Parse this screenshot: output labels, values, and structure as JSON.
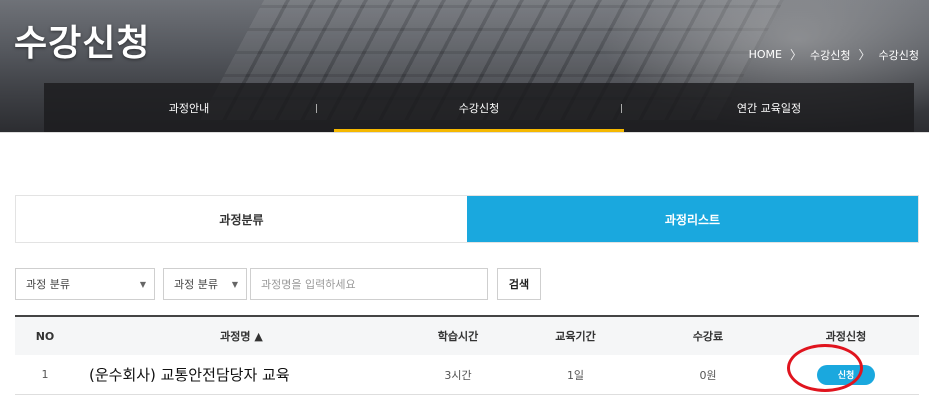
{
  "page": {
    "title": "수강신청"
  },
  "breadcrumb": {
    "home": "HOME",
    "level1": "수강신청",
    "level2": "수강신청",
    "sep": "〉"
  },
  "subnav": {
    "items": [
      "과정안내",
      "수강신청",
      "연간 교육일정"
    ]
  },
  "category_tabs": {
    "left": "과정분류",
    "right": "과정리스트"
  },
  "search": {
    "select1": "과정 분류",
    "select2": "과정 분류",
    "arrow": "▼",
    "placeholder": "과정명을 입력하세요",
    "button": "검색"
  },
  "table": {
    "headers": {
      "no": "NO",
      "name": "과정명 ▲",
      "time": "학습시간",
      "period": "교육기간",
      "fee": "수강료",
      "apply": "과정신청"
    },
    "rows": [
      {
        "no": "1",
        "name": "(운수회사) 교통안전담당자 교육",
        "time": "3시간",
        "period": "1일",
        "fee": "0원",
        "apply": "신청"
      }
    ]
  },
  "colors": {
    "accent": "#1aa8de",
    "highlight": "#e0141e",
    "tab_underline": "#f5b800"
  }
}
